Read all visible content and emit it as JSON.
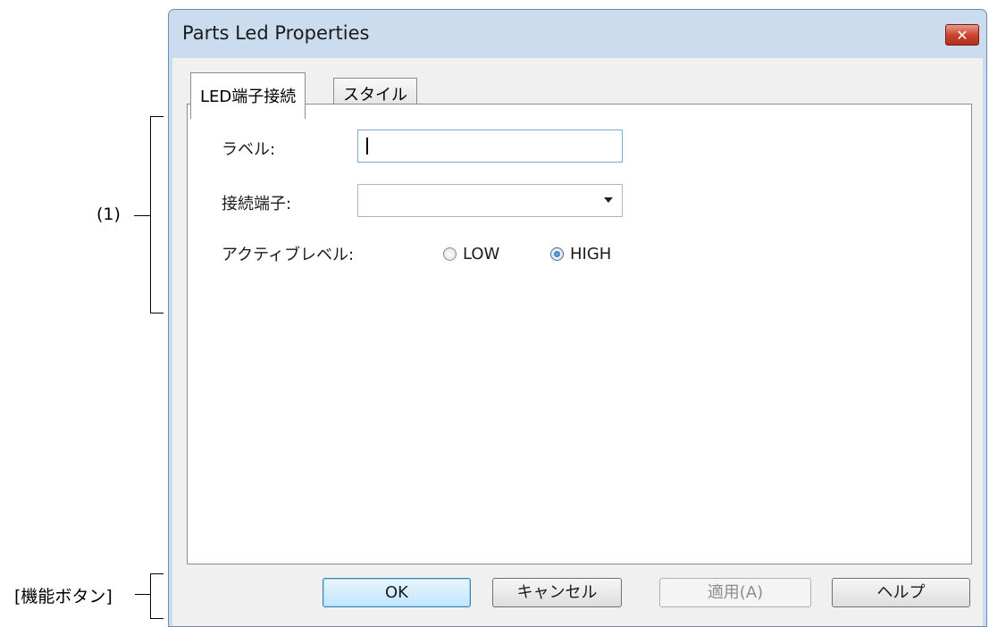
{
  "annotations": {
    "area_1": "(1)",
    "function_buttons": "[機能ボタン]"
  },
  "dialog": {
    "title": "Parts Led Properties",
    "close_glyph": "✕",
    "tabs": [
      {
        "label": "LED端子接続",
        "active": true
      },
      {
        "label": "スタイル",
        "active": false
      }
    ],
    "fields": {
      "label_caption": "ラベル:",
      "label_value": "",
      "terminal_caption": "接続端子:",
      "terminal_value": "",
      "active_level_caption": "アクティブレベル:",
      "active_level_options": [
        "LOW",
        "HIGH"
      ],
      "active_level_selected": "HIGH"
    },
    "buttons": {
      "ok": "OK",
      "cancel": "キャンセル",
      "apply": "適用(A)",
      "help": "ヘルプ"
    }
  }
}
